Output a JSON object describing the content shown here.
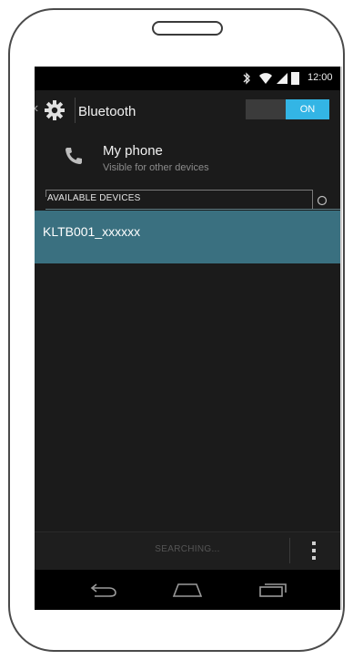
{
  "status_bar": {
    "time": "12:00",
    "icons": [
      "bluetooth-icon",
      "wifi-icon",
      "signal-icon",
      "battery-icon"
    ]
  },
  "action_bar": {
    "title": "Bluetooth",
    "toggle_label": "ON",
    "icon": "gear-icon"
  },
  "my_phone": {
    "title": "My phone",
    "subtitle": "Visible for other devices"
  },
  "available_devices": {
    "header": "AVAILABLE DEVICES",
    "devices": [
      {
        "name": "KLTB001_xxxxxx"
      }
    ]
  },
  "bottom_bar": {
    "status": "SEARCHING..."
  },
  "colors": {
    "accent": "#33b5e5",
    "selected_row": "#3a7080",
    "screen_bg": "#1b1b1b"
  }
}
